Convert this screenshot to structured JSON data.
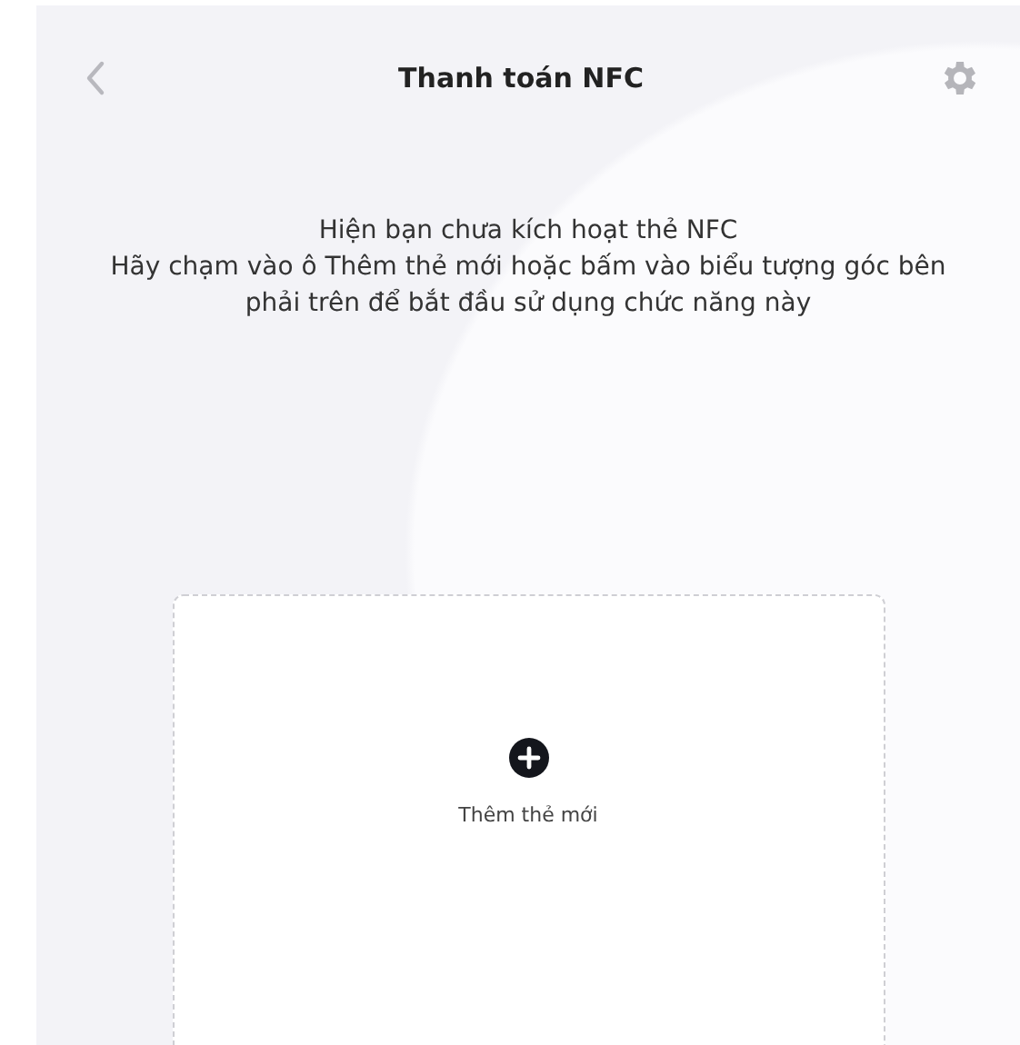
{
  "header": {
    "title": "Thanh toán NFC"
  },
  "message": [
    "Hiện bạn chưa kích hoạt thẻ NFC",
    "Hãy chạm vào ô Thêm thẻ mới hoặc bấm vào biểu tượng góc bên phải trên để bắt đầu sử dụng chức năng này"
  ],
  "add_card": {
    "label": "Thêm thẻ mới"
  }
}
